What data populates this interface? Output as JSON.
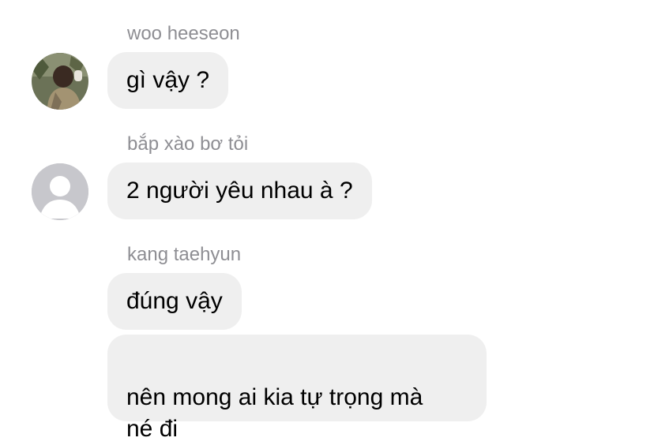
{
  "messages": [
    {
      "sender": "woo heeseon",
      "bubbles": [
        "gì vậy ?"
      ],
      "avatar": "photo-avatar"
    },
    {
      "sender": "bắp xào bơ tỏi",
      "bubbles": [
        "2 người yêu nhau à ?"
      ],
      "avatar": "default-person-icon"
    },
    {
      "sender": "kang taehyun",
      "bubbles": [
        "đúng vậy",
        "nên mong ai kia tự trọng mà\nné đi"
      ]
    }
  ],
  "colors": {
    "bubble_bg": "#efefef",
    "sender_text": "#8e8e93",
    "message_text": "#000000",
    "default_avatar_bg": "#c7c7cc"
  }
}
